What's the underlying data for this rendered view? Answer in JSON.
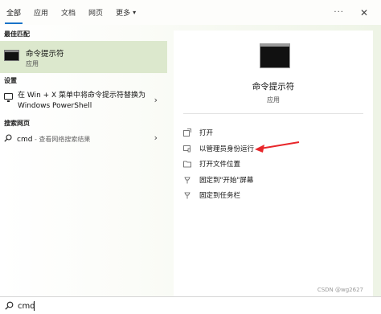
{
  "tabs": [
    {
      "label": "全部",
      "active": true
    },
    {
      "label": "应用",
      "active": false
    },
    {
      "label": "文档",
      "active": false
    },
    {
      "label": "网页",
      "active": false
    },
    {
      "label": "更多",
      "active": false,
      "has_dropdown": true
    }
  ],
  "topbar": {
    "more_icon": "ellipsis-icon",
    "close_icon": "close-icon"
  },
  "left": {
    "best_match": {
      "heading": "最佳匹配",
      "title": "命令提示符",
      "subtitle": "应用",
      "icon": "terminal-icon"
    },
    "settings": {
      "heading": "设置",
      "item_text": "在 Win + X 菜单中将命令提示符替换为 Windows PowerShell",
      "icon": "monitor-icon"
    },
    "web": {
      "heading": "搜索网页",
      "query": "cmd",
      "hint": " - 查看网络搜索结果",
      "icon": "search-icon"
    }
  },
  "right": {
    "title": "命令提示符",
    "subtitle": "应用",
    "icon": "terminal-icon",
    "actions": [
      {
        "label": "打开",
        "icon": "open-icon"
      },
      {
        "label": "以管理员身份运行",
        "icon": "shield-admin-icon"
      },
      {
        "label": "打开文件位置",
        "icon": "folder-icon"
      },
      {
        "label": "固定到\"开始\"屏幕",
        "icon": "pin-icon"
      },
      {
        "label": "固定到任务栏",
        "icon": "pin-icon"
      }
    ],
    "watermark": "CSDN @wg2627"
  },
  "annotation": {
    "color": "#e8262a"
  },
  "search": {
    "value": "cmd",
    "placeholder": ""
  },
  "colors": {
    "accent": "#1a73c9",
    "selected_bg": "#dce8cd"
  }
}
